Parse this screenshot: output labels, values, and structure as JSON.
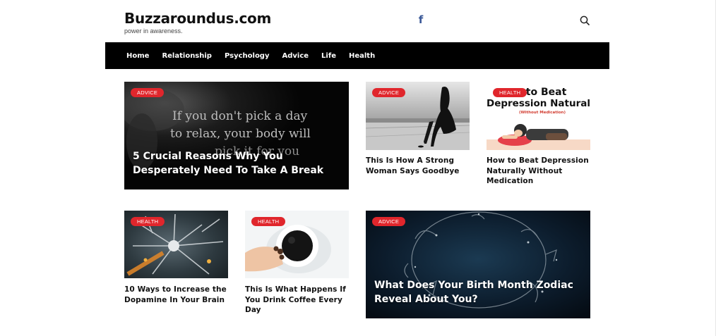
{
  "site": {
    "logo": "Buzzaroundus.com",
    "tagline": "power in awareness."
  },
  "header": {
    "facebook_icon": "facebook-icon",
    "search_icon": "search-icon"
  },
  "nav": {
    "items": [
      {
        "label": "Home"
      },
      {
        "label": "Relationship"
      },
      {
        "label": "Psychology"
      },
      {
        "label": "Advice"
      },
      {
        "label": "Life"
      },
      {
        "label": "Health"
      }
    ]
  },
  "posts": {
    "featured_1": {
      "category": "ADVICE",
      "title": "5 Crucial Reasons Why You Desperately Need To Take A Break",
      "image_quote_line1": "If you don't pick a day",
      "image_quote_line2": "to relax, your body will",
      "image_quote_line3": "pick it for you"
    },
    "post_2": {
      "category": "ADVICE",
      "title": "This Is How A Strong Woman Says Goodbye"
    },
    "post_3": {
      "category": "HEALTH",
      "title": "How to Beat Depression Naturally Without Medication",
      "image_text_line1": "w to Beat",
      "image_text_line2": "Depression Naturally",
      "image_text_line3": "(Without Medication)"
    },
    "post_4": {
      "category": "HEALTH",
      "title": "10 Ways to Increase the Dopamine In Your Brain"
    },
    "post_5": {
      "category": "HEALTH",
      "title": "This Is What Happens If You Drink Coffee Every Day"
    },
    "featured_2": {
      "category": "ADVICE",
      "title": "What Does Your Birth Month Zodiac Reveal About You?"
    }
  },
  "colors": {
    "accent": "#e0262c",
    "nav_bg": "#000000",
    "facebook": "#3b5998"
  }
}
